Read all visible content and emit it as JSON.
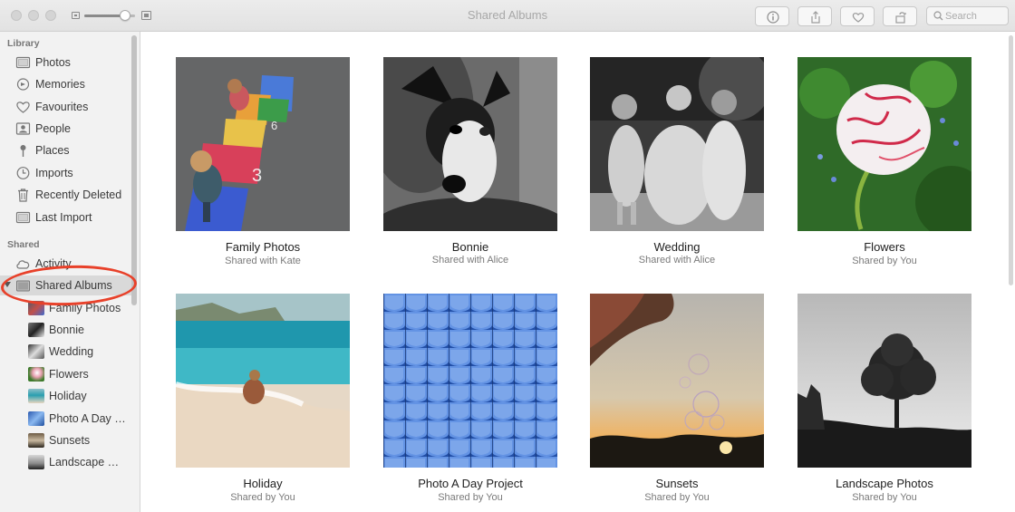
{
  "window": {
    "title": "Shared Albums"
  },
  "toolbar": {
    "buttons": [
      {
        "name": "info-button",
        "icon": "info-icon"
      },
      {
        "name": "share-button",
        "icon": "share-icon"
      },
      {
        "name": "favourite-button",
        "icon": "heart-icon"
      },
      {
        "name": "rotate-button",
        "icon": "rotate-icon"
      }
    ],
    "search_placeholder": "Search",
    "zoom_level": 0.8
  },
  "sidebar": {
    "library_header": "Library",
    "library_items": [
      {
        "label": "Photos",
        "icon": "photos-icon"
      },
      {
        "label": "Memories",
        "icon": "memories-icon"
      },
      {
        "label": "Favourites",
        "icon": "heart-icon"
      },
      {
        "label": "People",
        "icon": "people-icon"
      },
      {
        "label": "Places",
        "icon": "pin-icon"
      },
      {
        "label": "Imports",
        "icon": "clock-icon"
      },
      {
        "label": "Recently Deleted",
        "icon": "trash-icon"
      },
      {
        "label": "Last Import",
        "icon": "photos-icon"
      }
    ],
    "shared_header": "Shared",
    "shared_items": [
      {
        "label": "Activity",
        "icon": "cloud-icon"
      },
      {
        "label": "Shared Albums",
        "icon": "folder-icon",
        "selected": true
      }
    ],
    "albums": [
      {
        "label": "Family Photos"
      },
      {
        "label": "Bonnie"
      },
      {
        "label": "Wedding"
      },
      {
        "label": "Flowers"
      },
      {
        "label": "Holiday"
      },
      {
        "label": "Photo A Day Project"
      },
      {
        "label": "Sunsets"
      },
      {
        "label": "Landscape Photos"
      }
    ]
  },
  "main": {
    "albums": [
      {
        "name": "Family Photos",
        "subtitle": "Shared with Kate"
      },
      {
        "name": "Bonnie",
        "subtitle": "Shared with Alice"
      },
      {
        "name": "Wedding",
        "subtitle": "Shared with Alice"
      },
      {
        "name": "Flowers",
        "subtitle": "Shared by You"
      },
      {
        "name": "Holiday",
        "subtitle": "Shared by You"
      },
      {
        "name": "Photo A Day Project",
        "subtitle": "Shared by You"
      },
      {
        "name": "Sunsets",
        "subtitle": "Shared by You"
      },
      {
        "name": "Landscape Photos",
        "subtitle": "Shared by You"
      }
    ]
  }
}
